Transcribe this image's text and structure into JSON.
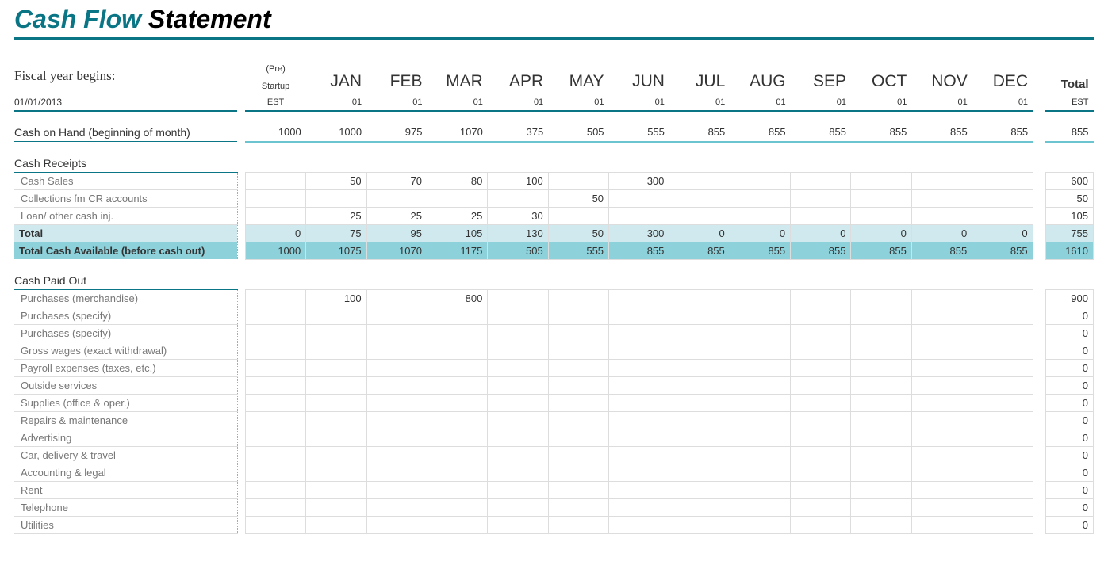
{
  "title_accent": "Cash Flow",
  "title_rest": " Statement",
  "fiscal_label": "Fiscal year begins:",
  "fiscal_date": "01/01/2013",
  "pre_top": "(Pre)",
  "pre_mid": "Startup",
  "pre_est": "EST",
  "months": [
    "JAN",
    "FEB",
    "MAR",
    "APR",
    "MAY",
    "JUN",
    "JUL",
    "AUG",
    "SEP",
    "OCT",
    "NOV",
    "DEC"
  ],
  "month_sub": "01",
  "total_h": "Total",
  "total_est": "EST",
  "coh_label": "Cash on Hand (beginning of month)",
  "coh": {
    "pre": "1000",
    "m": [
      "1000",
      "975",
      "1070",
      "375",
      "505",
      "555",
      "855",
      "855",
      "855",
      "855",
      "855",
      "855"
    ],
    "t": "855"
  },
  "receipts_section": "Cash Receipts",
  "receipts": [
    {
      "label": "Cash Sales",
      "pre": "",
      "m": [
        "50",
        "70",
        "80",
        "100",
        "",
        "300",
        "",
        "",
        "",
        "",
        "",
        ""
      ],
      "t": "600"
    },
    {
      "label": "Collections fm CR accounts",
      "pre": "",
      "m": [
        "",
        "",
        "",
        "",
        "50",
        "",
        "",
        "",
        "",
        "",
        "",
        ""
      ],
      "t": "50"
    },
    {
      "label": "Loan/ other cash inj.",
      "pre": "",
      "m": [
        "25",
        "25",
        "25",
        "30",
        "",
        "",
        "",
        "",
        "",
        "",
        "",
        ""
      ],
      "t": "105"
    }
  ],
  "receipts_total_label": "Total",
  "receipts_total": {
    "pre": "0",
    "m": [
      "75",
      "95",
      "105",
      "130",
      "50",
      "300",
      "0",
      "0",
      "0",
      "0",
      "0",
      "0"
    ],
    "t": "755"
  },
  "tca_label": "Total Cash Available (before cash out)",
  "tca": {
    "pre": "1000",
    "m": [
      "1075",
      "1070",
      "1175",
      "505",
      "555",
      "855",
      "855",
      "855",
      "855",
      "855",
      "855",
      "855"
    ],
    "t": "1610"
  },
  "paid_section": "Cash Paid Out",
  "paid": [
    {
      "label": "Purchases (merchandise)",
      "pre": "",
      "m": [
        "100",
        "",
        "800",
        "",
        "",
        "",
        "",
        "",
        "",
        "",
        "",
        ""
      ],
      "t": "900"
    },
    {
      "label": "Purchases (specify)",
      "pre": "",
      "m": [
        "",
        "",
        "",
        "",
        "",
        "",
        "",
        "",
        "",
        "",
        "",
        ""
      ],
      "t": "0"
    },
    {
      "label": "Purchases (specify)",
      "pre": "",
      "m": [
        "",
        "",
        "",
        "",
        "",
        "",
        "",
        "",
        "",
        "",
        "",
        ""
      ],
      "t": "0"
    },
    {
      "label": "Gross wages (exact withdrawal)",
      "pre": "",
      "m": [
        "",
        "",
        "",
        "",
        "",
        "",
        "",
        "",
        "",
        "",
        "",
        ""
      ],
      "t": "0"
    },
    {
      "label": "Payroll expenses (taxes, etc.)",
      "pre": "",
      "m": [
        "",
        "",
        "",
        "",
        "",
        "",
        "",
        "",
        "",
        "",
        "",
        ""
      ],
      "t": "0"
    },
    {
      "label": "Outside services",
      "pre": "",
      "m": [
        "",
        "",
        "",
        "",
        "",
        "",
        "",
        "",
        "",
        "",
        "",
        ""
      ],
      "t": "0"
    },
    {
      "label": "Supplies (office & oper.)",
      "pre": "",
      "m": [
        "",
        "",
        "",
        "",
        "",
        "",
        "",
        "",
        "",
        "",
        "",
        ""
      ],
      "t": "0"
    },
    {
      "label": "Repairs & maintenance",
      "pre": "",
      "m": [
        "",
        "",
        "",
        "",
        "",
        "",
        "",
        "",
        "",
        "",
        "",
        ""
      ],
      "t": "0"
    },
    {
      "label": "Advertising",
      "pre": "",
      "m": [
        "",
        "",
        "",
        "",
        "",
        "",
        "",
        "",
        "",
        "",
        "",
        ""
      ],
      "t": "0"
    },
    {
      "label": "Car, delivery & travel",
      "pre": "",
      "m": [
        "",
        "",
        "",
        "",
        "",
        "",
        "",
        "",
        "",
        "",
        "",
        ""
      ],
      "t": "0"
    },
    {
      "label": "Accounting & legal",
      "pre": "",
      "m": [
        "",
        "",
        "",
        "",
        "",
        "",
        "",
        "",
        "",
        "",
        "",
        ""
      ],
      "t": "0"
    },
    {
      "label": "Rent",
      "pre": "",
      "m": [
        "",
        "",
        "",
        "",
        "",
        "",
        "",
        "",
        "",
        "",
        "",
        ""
      ],
      "t": "0"
    },
    {
      "label": "Telephone",
      "pre": "",
      "m": [
        "",
        "",
        "",
        "",
        "",
        "",
        "",
        "",
        "",
        "",
        "",
        ""
      ],
      "t": "0"
    },
    {
      "label": "Utilities",
      "pre": "",
      "m": [
        "",
        "",
        "",
        "",
        "",
        "",
        "",
        "",
        "",
        "",
        "",
        ""
      ],
      "t": "0"
    }
  ],
  "chart_data": {
    "type": "table",
    "title": "Cash Flow Statement",
    "fiscal_year_start": "01/01/2013",
    "columns": [
      "(Pre) Startup EST",
      "JAN",
      "FEB",
      "MAR",
      "APR",
      "MAY",
      "JUN",
      "JUL",
      "AUG",
      "SEP",
      "OCT",
      "NOV",
      "DEC",
      "Total EST"
    ],
    "rows": [
      {
        "name": "Cash on Hand (beginning of month)",
        "values": [
          1000,
          1000,
          975,
          1070,
          375,
          505,
          555,
          855,
          855,
          855,
          855,
          855,
          855,
          855
        ]
      },
      {
        "name": "Cash Sales",
        "values": [
          null,
          50,
          70,
          80,
          100,
          null,
          300,
          null,
          null,
          null,
          null,
          null,
          null,
          600
        ]
      },
      {
        "name": "Collections fm CR accounts",
        "values": [
          null,
          null,
          null,
          null,
          null,
          50,
          null,
          null,
          null,
          null,
          null,
          null,
          null,
          50
        ]
      },
      {
        "name": "Loan/ other cash inj.",
        "values": [
          null,
          25,
          25,
          25,
          30,
          null,
          null,
          null,
          null,
          null,
          null,
          null,
          null,
          105
        ]
      },
      {
        "name": "Cash Receipts Total",
        "values": [
          0,
          75,
          95,
          105,
          130,
          50,
          300,
          0,
          0,
          0,
          0,
          0,
          0,
          755
        ]
      },
      {
        "name": "Total Cash Available (before cash out)",
        "values": [
          1000,
          1075,
          1070,
          1175,
          505,
          555,
          855,
          855,
          855,
          855,
          855,
          855,
          855,
          1610
        ]
      },
      {
        "name": "Purchases (merchandise)",
        "values": [
          null,
          100,
          null,
          800,
          null,
          null,
          null,
          null,
          null,
          null,
          null,
          null,
          null,
          900
        ]
      },
      {
        "name": "Purchases (specify)",
        "values": [
          null,
          null,
          null,
          null,
          null,
          null,
          null,
          null,
          null,
          null,
          null,
          null,
          null,
          0
        ]
      },
      {
        "name": "Purchases (specify)",
        "values": [
          null,
          null,
          null,
          null,
          null,
          null,
          null,
          null,
          null,
          null,
          null,
          null,
          null,
          0
        ]
      },
      {
        "name": "Gross wages (exact withdrawal)",
        "values": [
          null,
          null,
          null,
          null,
          null,
          null,
          null,
          null,
          null,
          null,
          null,
          null,
          null,
          0
        ]
      },
      {
        "name": "Payroll expenses (taxes, etc.)",
        "values": [
          null,
          null,
          null,
          null,
          null,
          null,
          null,
          null,
          null,
          null,
          null,
          null,
          null,
          0
        ]
      },
      {
        "name": "Outside services",
        "values": [
          null,
          null,
          null,
          null,
          null,
          null,
          null,
          null,
          null,
          null,
          null,
          null,
          null,
          0
        ]
      },
      {
        "name": "Supplies (office & oper.)",
        "values": [
          null,
          null,
          null,
          null,
          null,
          null,
          null,
          null,
          null,
          null,
          null,
          null,
          null,
          0
        ]
      },
      {
        "name": "Repairs & maintenance",
        "values": [
          null,
          null,
          null,
          null,
          null,
          null,
          null,
          null,
          null,
          null,
          null,
          null,
          null,
          0
        ]
      },
      {
        "name": "Advertising",
        "values": [
          null,
          null,
          null,
          null,
          null,
          null,
          null,
          null,
          null,
          null,
          null,
          null,
          null,
          0
        ]
      },
      {
        "name": "Car, delivery & travel",
        "values": [
          null,
          null,
          null,
          null,
          null,
          null,
          null,
          null,
          null,
          null,
          null,
          null,
          null,
          0
        ]
      },
      {
        "name": "Accounting & legal",
        "values": [
          null,
          null,
          null,
          null,
          null,
          null,
          null,
          null,
          null,
          null,
          null,
          null,
          null,
          0
        ]
      },
      {
        "name": "Rent",
        "values": [
          null,
          null,
          null,
          null,
          null,
          null,
          null,
          null,
          null,
          null,
          null,
          null,
          null,
          0
        ]
      },
      {
        "name": "Telephone",
        "values": [
          null,
          null,
          null,
          null,
          null,
          null,
          null,
          null,
          null,
          null,
          null,
          null,
          null,
          0
        ]
      },
      {
        "name": "Utilities",
        "values": [
          null,
          null,
          null,
          null,
          null,
          null,
          null,
          null,
          null,
          null,
          null,
          null,
          null,
          0
        ]
      }
    ]
  }
}
